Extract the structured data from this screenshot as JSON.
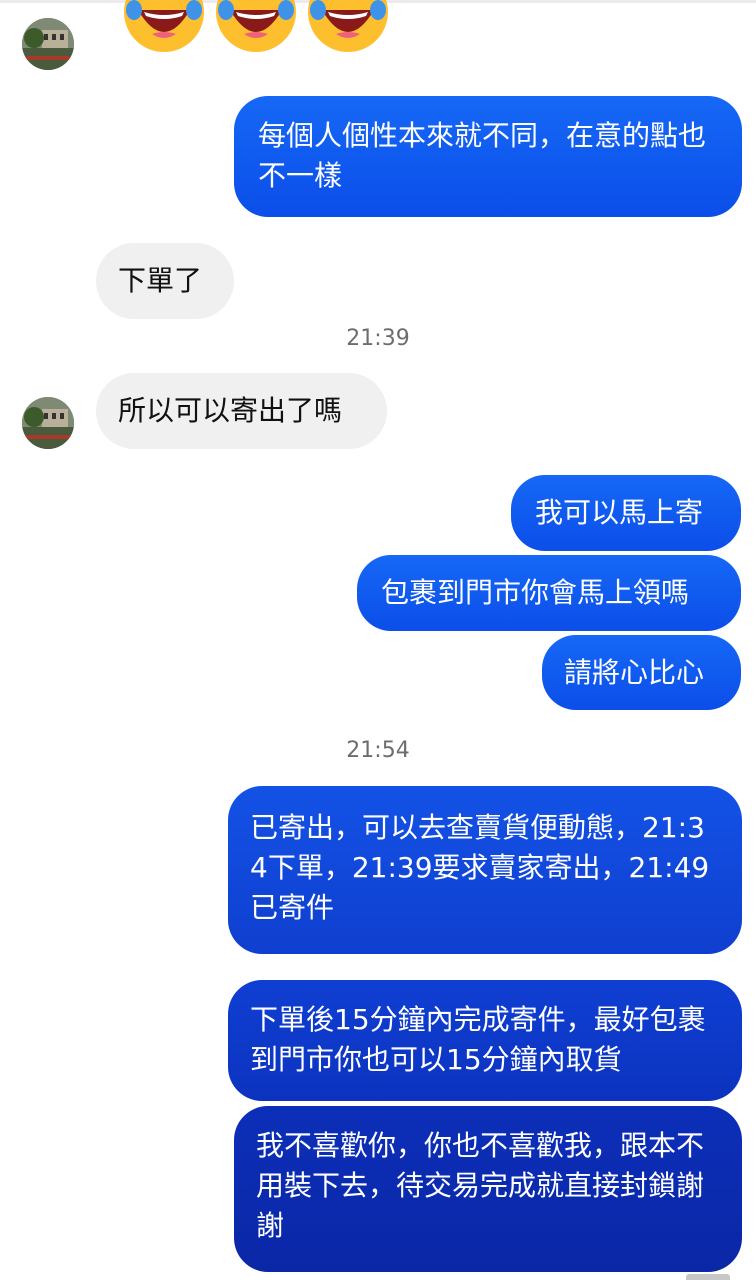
{
  "conversation": {
    "timestamps": [
      "21:39",
      "21:54"
    ],
    "messages": [
      {
        "from": "them",
        "text": "下單了"
      },
      {
        "from": "them",
        "text": "所以可以寄出了嗎"
      },
      {
        "from": "me",
        "text": "每個人個性本來就不同，在意的點也不一樣"
      },
      {
        "from": "me",
        "text": "我可以馬上寄"
      },
      {
        "from": "me",
        "text": "包裹到門市你會馬上領嗎"
      },
      {
        "from": "me",
        "text": "請將心比心"
      },
      {
        "from": "me",
        "text": "已寄出，可以去查賣貨便動態，21:34下單，21:39要求賣家寄出，21:49已寄件"
      },
      {
        "from": "me",
        "text": "下單後15分鐘內完成寄件，最好包裹到門市你也可以15分鐘內取貨"
      },
      {
        "from": "me",
        "text": "我不喜歡你，你也不喜歡我，跟本不用裝下去，待交易完成就直接封鎖謝謝"
      }
    ],
    "reactions": {
      "emoji": "laughing-with-tears",
      "count": 3
    },
    "colors": {
      "outgoing_top": "#1668f6",
      "outgoing_bottom": "#0b2fae",
      "incoming": "#f0f0f0"
    }
  }
}
